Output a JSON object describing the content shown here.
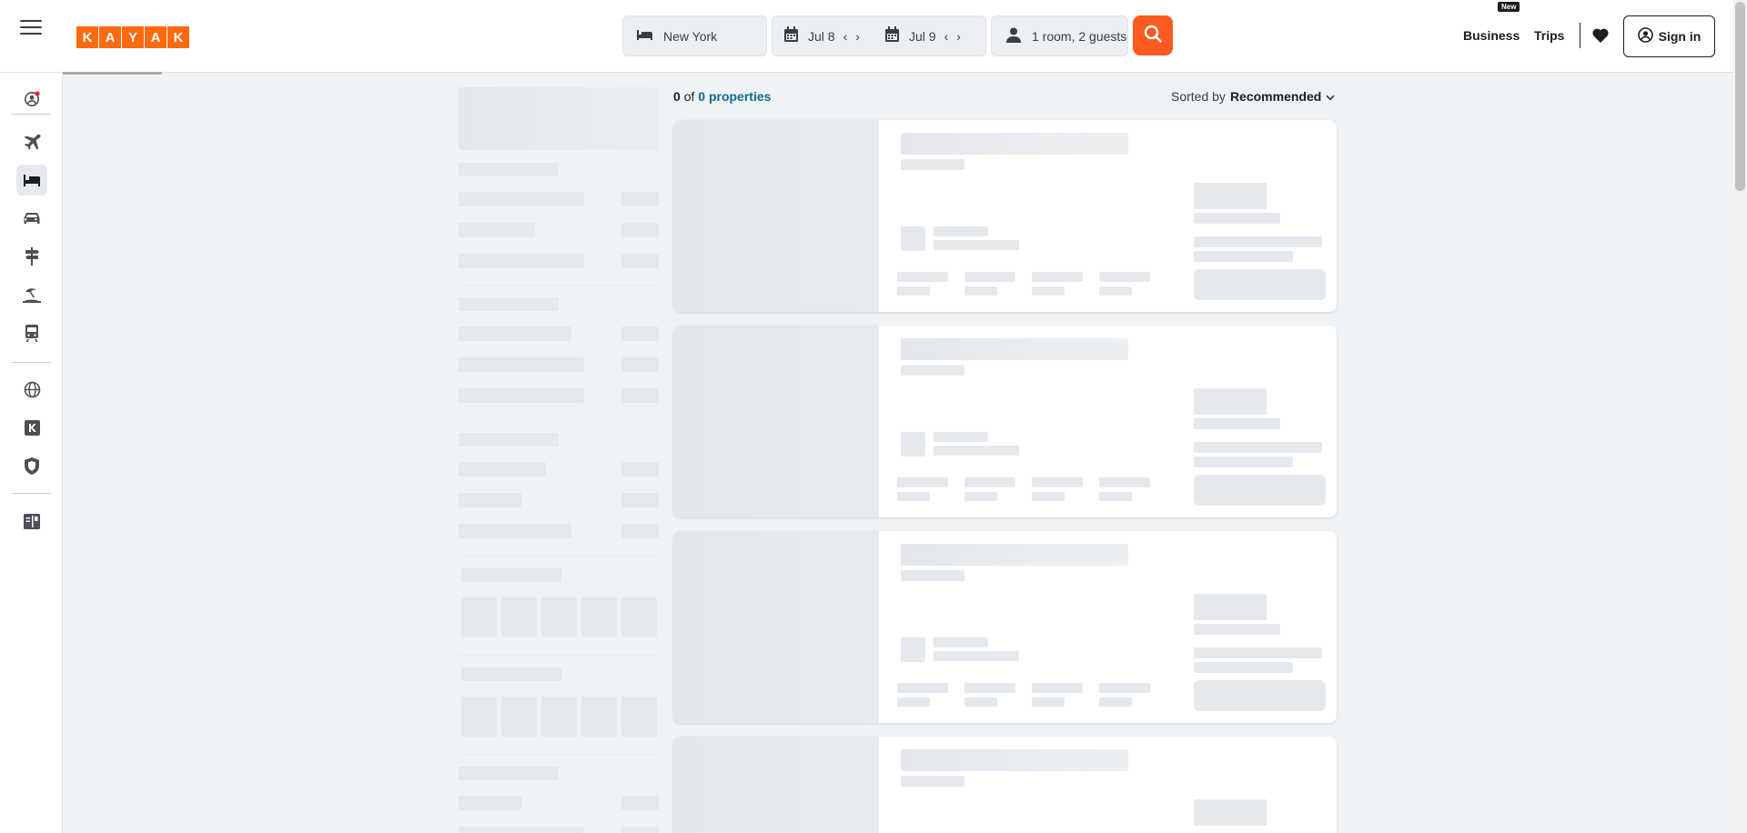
{
  "header": {
    "logo_letters": [
      "K",
      "A",
      "Y",
      "A",
      "K"
    ],
    "search": {
      "location": "New York",
      "checkin": "Jul 8",
      "checkout": "Jul 9",
      "guests": "1 room, 2 guests"
    },
    "business_label": "Business",
    "business_badge": "New",
    "trips_label": "Trips",
    "signin_label": "Sign in"
  },
  "sidebar": {
    "icons": [
      "account-icon",
      "flights-icon",
      "stays-icon",
      "cars-icon",
      "packages-icon",
      "vacation-icon",
      "trains-icon",
      "explore-icon",
      "kayak-business-icon",
      "trips-protect-icon",
      "travel-guide-icon"
    ],
    "active": "stays-icon"
  },
  "results": {
    "count": "0",
    "of_word": "of",
    "total": "0 properties",
    "sorted_by_label": "Sorted by",
    "sorted_value": "Recommended"
  },
  "colors": {
    "brand": "#ff690f",
    "search_button": "#ff5a1f",
    "link_blue": "#0d6b8c",
    "skeleton": "#e5e9ee"
  }
}
